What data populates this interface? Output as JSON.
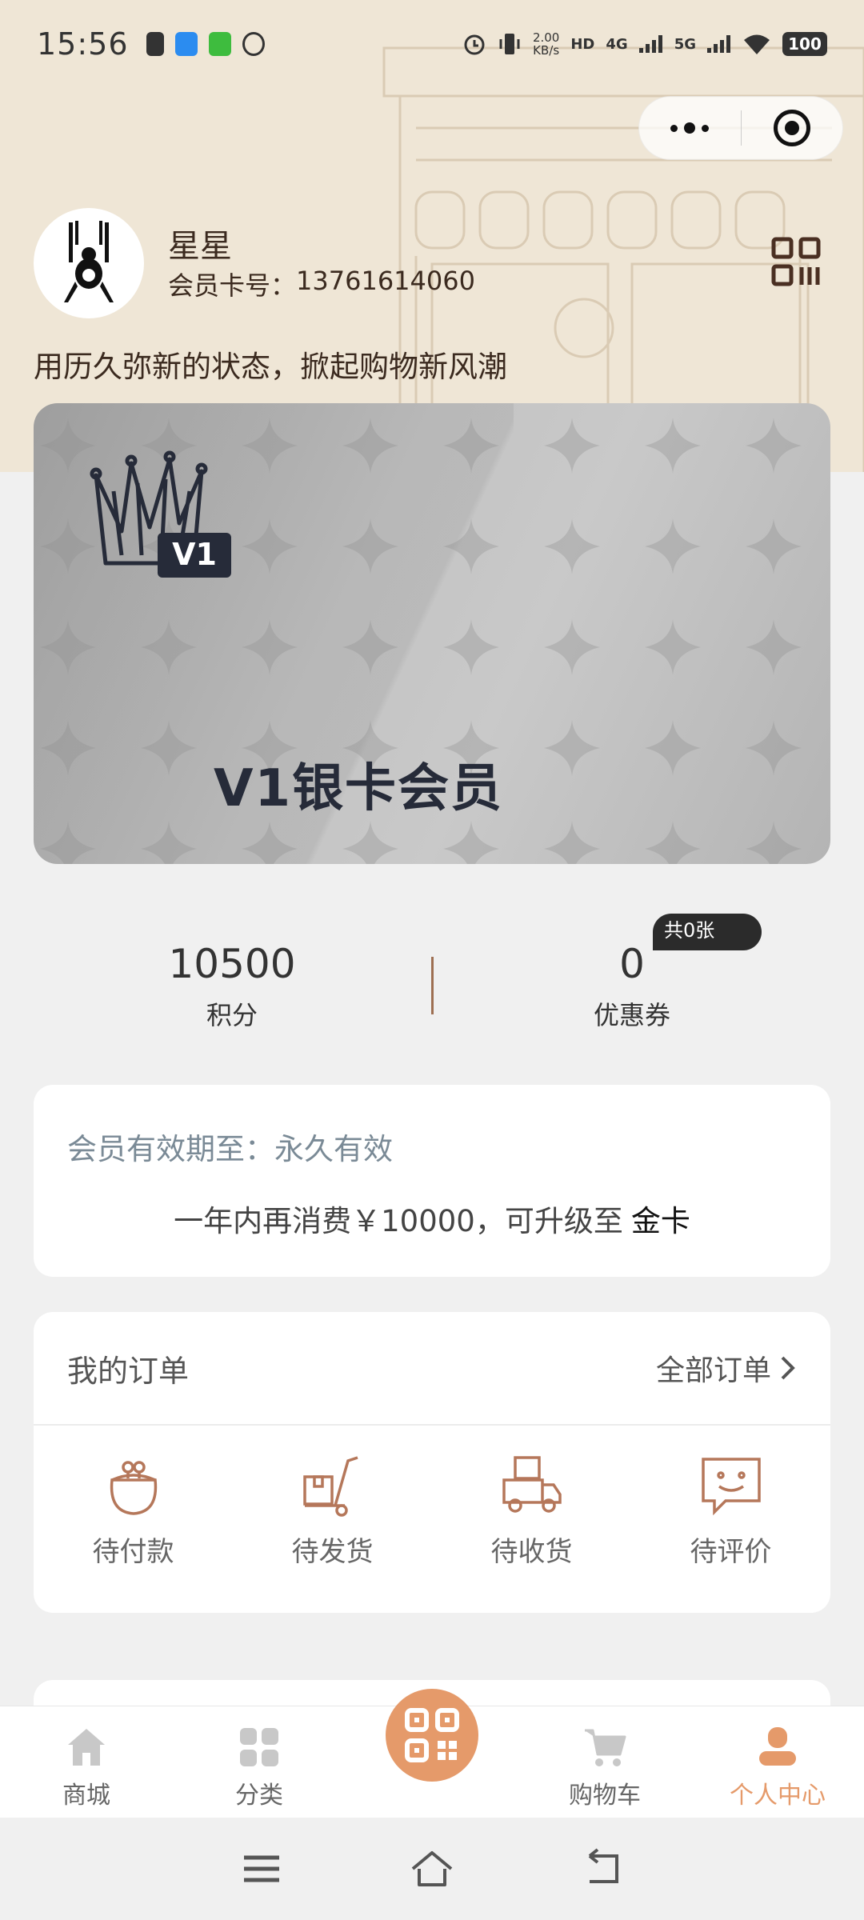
{
  "status_bar": {
    "time": "15:56",
    "speed_value": "2.00",
    "speed_unit": "KB/s",
    "hd_label": "HD",
    "net_4g": "4G",
    "net_5g": "5G",
    "battery": "100"
  },
  "profile": {
    "username": "星星",
    "card_label": "会员卡号：",
    "card_number": "13761614060",
    "slogan": "用历久弥新的状态，掀起购物新风潮"
  },
  "vip_card": {
    "level_badge": "V1",
    "title": "V1银卡会员"
  },
  "stats": {
    "points_value": "10500",
    "points_label": "积分",
    "coupons_value": "0",
    "coupons_label": "优惠券",
    "coupons_badge": "共0张"
  },
  "validity": {
    "label": "会员有效期至：",
    "value": "永久有效",
    "upgrade_text": "一年内再消费￥10000，可升级至",
    "upgrade_level": "金卡"
  },
  "orders": {
    "title": "我的订单",
    "all_label": "全部订单",
    "items": [
      {
        "label": "待付款",
        "icon": "purse-icon"
      },
      {
        "label": "待发货",
        "icon": "hand-truck-icon"
      },
      {
        "label": "待收货",
        "icon": "delivery-truck-icon"
      },
      {
        "label": "待评价",
        "icon": "comment-smile-icon"
      }
    ]
  },
  "tabbar": {
    "items": [
      {
        "label": "商城",
        "icon": "home-icon"
      },
      {
        "label": "分类",
        "icon": "grid-icon"
      },
      {
        "label": "",
        "icon": "qr-scan-icon"
      },
      {
        "label": "购物车",
        "icon": "cart-icon"
      },
      {
        "label": "个人中心",
        "icon": "person-icon"
      }
    ],
    "active_index": 4
  },
  "colors": {
    "accent": "#e59a6a",
    "header_bg": "#efe6d6",
    "order_icon": "#b5775a",
    "card_text": "#262b39"
  }
}
